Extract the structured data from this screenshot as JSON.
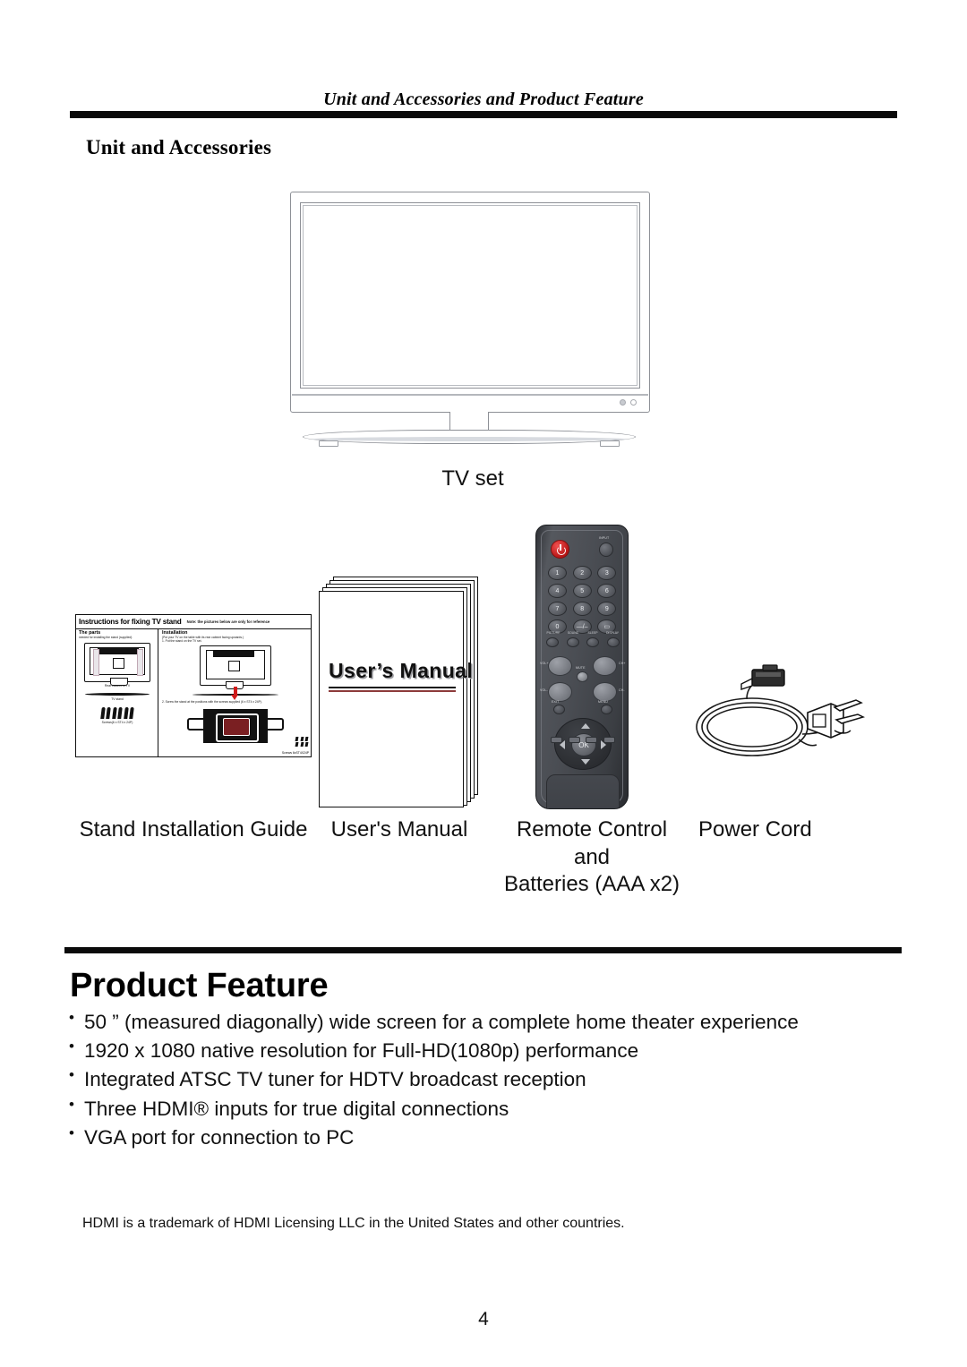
{
  "header": {
    "running_title": "Unit and Accessories and Product Feature"
  },
  "unit_section": {
    "title": "Unit and Accessories",
    "tv": {
      "caption": "TV set"
    },
    "accessories": [
      {
        "caption": "Stand Installation Guide"
      },
      {
        "caption": "User's Manual"
      },
      {
        "caption_line1": "Remote Control and",
        "caption_line2": "Batteries (AAA x2)"
      },
      {
        "caption": "Power Cord"
      }
    ]
  },
  "stand_guide": {
    "title": "Instructions for fixing TV stand",
    "note": "Note: the pictures below are only for reference",
    "left_heading": "The parts",
    "left_sub": "needed for installing the stand (supplied)",
    "label_rear_cabinet": "Rear cabinet of TV",
    "label_tv_stand": "TV stand",
    "label_screws": "Screws(6 x ST4 x 24P)",
    "right_heading": "Installation",
    "right_sub": "(Put your TV on the table with its rear cabinet facing upwards.)",
    "step1": "1. Put the stand on the TV set.",
    "step2": "2. Screw the stand at the positions with the screws supplied (6 x ST4 x 24P).",
    "screws_caption": "Screws 6xST4X24P"
  },
  "manual_cover": {
    "title": "User’s Manual"
  },
  "remote": {
    "power_label": "POWER",
    "input_label": "INPUT",
    "keys": [
      "1",
      "2",
      "3",
      "4",
      "5",
      "6",
      "7",
      "8",
      "9",
      "0"
    ],
    "dash_key": "—/–",
    "wide_key": "▭",
    "function_labels": [
      "PICTURE",
      "SOUND",
      "SLEEP",
      "DISPLAY"
    ],
    "vol_up": "VOL+",
    "vol_down": "VOL-",
    "ch_up": "CH+",
    "ch_down": "CH-",
    "mute_label": "MUTE",
    "exit_label": "EXIT",
    "menu_label": "MENU",
    "ok_label": "OK",
    "color_keys": [
      "",
      "",
      "",
      ""
    ]
  },
  "product_feature": {
    "title": "Product Feature",
    "bullets": [
      "50 ” (measured diagonally) wide screen for a complete home theater experience",
      "1920 x 1080 native resolution for Full-HD(1080p) performance",
      "Integrated ATSC TV tuner for HDTV broadcast reception",
      "Three HDMI® inputs for true digital connections",
      "VGA port for connection to PC"
    ]
  },
  "footer": {
    "trademark_note": "HDMI is a trademark of HDMI Licensing LLC in the United States and other countries.",
    "page_number": "4"
  },
  "colors": {
    "rule": "#0a0a0a",
    "text": "#111111",
    "tv_outline": "#8d9096",
    "power_button": "#b81616",
    "manual_rule_accent": "#8d3b3b"
  }
}
